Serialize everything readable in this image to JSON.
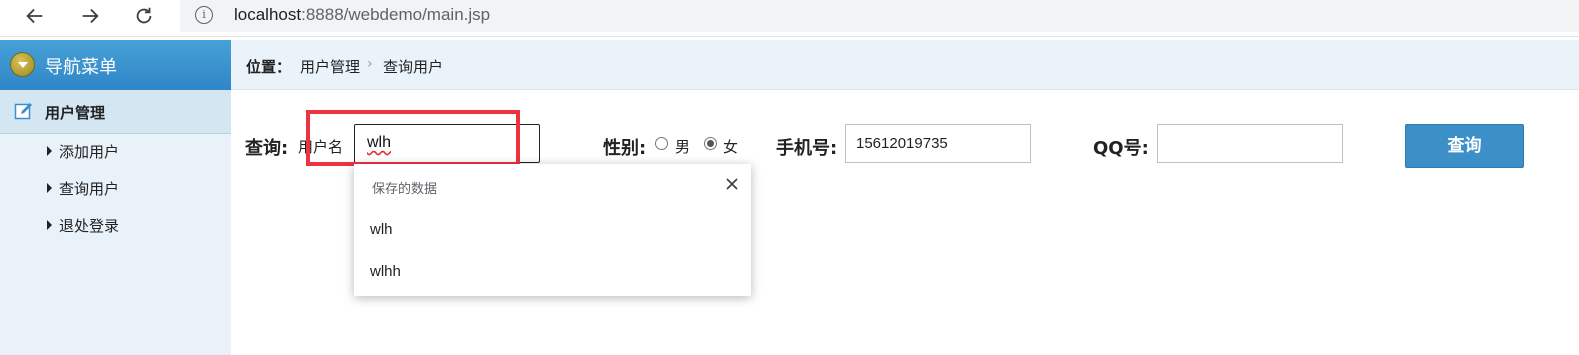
{
  "browser": {
    "url_host": "localhost",
    "url_rest": ":8888/webdemo/main.jsp",
    "info_icon_glyph": "i"
  },
  "sidebar": {
    "title": "导航菜单",
    "section": "用户管理",
    "items": [
      "添加用户",
      "查询用户",
      "退处登录"
    ]
  },
  "breadcrumb": {
    "label": "位置：",
    "item1": "用户管理",
    "separator": "›",
    "item2": "查询用户"
  },
  "query": {
    "label": "查询:",
    "username_label": "用户名",
    "username_value": "wlh",
    "gender_label": "性别:",
    "gender_options": [
      "男",
      "女"
    ],
    "gender_selected": "女",
    "phone_label": "手机号:",
    "phone_value": "15612019735",
    "qq_label": "QQ号:",
    "qq_value": "",
    "button_label": "查询"
  },
  "autofill": {
    "header": "保存的数据",
    "suggestions": [
      "wlh",
      "wlhh"
    ]
  },
  "colors": {
    "highlight": "#ee3340",
    "button": "#3d8fc8",
    "sidebar_header": "#2f86c6"
  }
}
